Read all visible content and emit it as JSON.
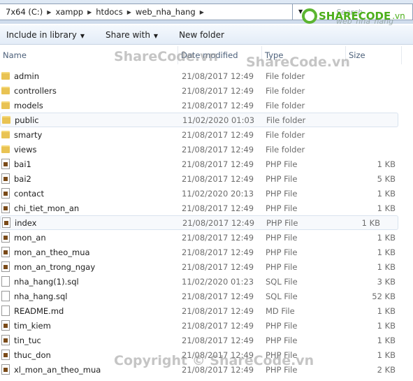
{
  "address": {
    "crumbs": [
      "7x64 (C:)",
      "xampp",
      "htdocs",
      "web_nha_hang"
    ],
    "search_placeholder": "Search web_nha_hang"
  },
  "toolbar": {
    "include": "Include in library",
    "share": "Share with",
    "new_folder": "New folder"
  },
  "columns": {
    "name": "Name",
    "date": "Date modified",
    "type": "Type",
    "size": "Size"
  },
  "files": [
    {
      "name": "admin",
      "date": "21/08/2017 12:49",
      "type": "File folder",
      "size": "",
      "icon": "folder"
    },
    {
      "name": "controllers",
      "date": "21/08/2017 12:49",
      "type": "File folder",
      "size": "",
      "icon": "folder"
    },
    {
      "name": "models",
      "date": "21/08/2017 12:49",
      "type": "File folder",
      "size": "",
      "icon": "folder"
    },
    {
      "name": "public",
      "date": "11/02/2020 01:03",
      "type": "File folder",
      "size": "",
      "icon": "folder",
      "highlighted": true
    },
    {
      "name": "smarty",
      "date": "21/08/2017 12:49",
      "type": "File folder",
      "size": "",
      "icon": "folder"
    },
    {
      "name": "views",
      "date": "21/08/2017 12:49",
      "type": "File folder",
      "size": "",
      "icon": "folder"
    },
    {
      "name": "bai1",
      "date": "21/08/2017 12:49",
      "type": "PHP File",
      "size": "1 KB",
      "icon": "php"
    },
    {
      "name": "bai2",
      "date": "21/08/2017 12:49",
      "type": "PHP File",
      "size": "5 KB",
      "icon": "php"
    },
    {
      "name": "contact",
      "date": "11/02/2020 20:13",
      "type": "PHP File",
      "size": "1 KB",
      "icon": "php"
    },
    {
      "name": "chi_tiet_mon_an",
      "date": "21/08/2017 12:49",
      "type": "PHP File",
      "size": "1 KB",
      "icon": "php"
    },
    {
      "name": "index",
      "date": "21/08/2017 12:49",
      "type": "PHP File",
      "size": "1 KB",
      "icon": "php",
      "highlighted": true
    },
    {
      "name": "mon_an",
      "date": "21/08/2017 12:49",
      "type": "PHP File",
      "size": "1 KB",
      "icon": "php"
    },
    {
      "name": "mon_an_theo_mua",
      "date": "21/08/2017 12:49",
      "type": "PHP File",
      "size": "1 KB",
      "icon": "php"
    },
    {
      "name": "mon_an_trong_ngay",
      "date": "21/08/2017 12:49",
      "type": "PHP File",
      "size": "1 KB",
      "icon": "php"
    },
    {
      "name": "nha_hang(1).sql",
      "date": "11/02/2020 01:23",
      "type": "SQL File",
      "size": "3 KB",
      "icon": "doc"
    },
    {
      "name": "nha_hang.sql",
      "date": "21/08/2017 12:49",
      "type": "SQL File",
      "size": "52 KB",
      "icon": "doc"
    },
    {
      "name": "README.md",
      "date": "21/08/2017 12:49",
      "type": "MD File",
      "size": "1 KB",
      "icon": "doc"
    },
    {
      "name": "tim_kiem",
      "date": "21/08/2017 12:49",
      "type": "PHP File",
      "size": "1 KB",
      "icon": "php"
    },
    {
      "name": "tin_tuc",
      "date": "21/08/2017 12:49",
      "type": "PHP File",
      "size": "1 KB",
      "icon": "php"
    },
    {
      "name": "thuc_don",
      "date": "21/08/2017 12:49",
      "type": "PHP File",
      "size": "1 KB",
      "icon": "php"
    },
    {
      "name": "xl_mon_an_theo_mua",
      "date": "21/08/2017 12:49",
      "type": "PHP File",
      "size": "2 KB",
      "icon": "php"
    }
  ],
  "watermarks": {
    "logo": "SHARECODE.vn",
    "mark1": "ShareCode.vn",
    "mark2": "ShareCode.vn",
    "copyright": "Copyright © ShareCode.vn"
  }
}
